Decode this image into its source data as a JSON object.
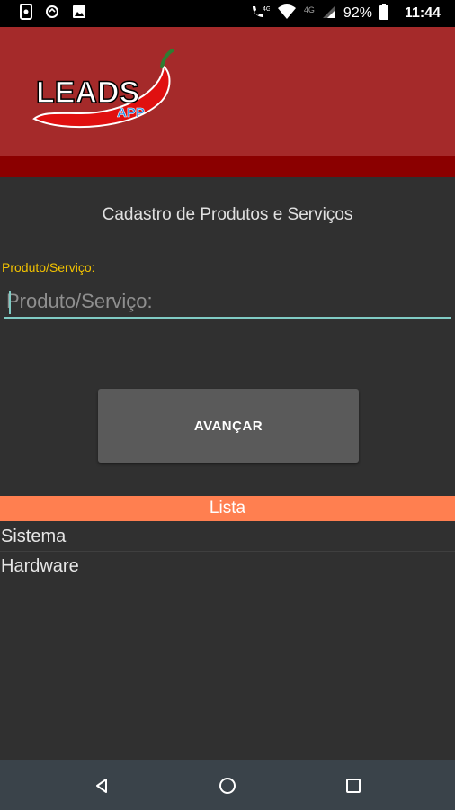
{
  "status_bar": {
    "icons_left": [
      "phone-icon",
      "sync-icon",
      "image-icon"
    ],
    "network_label": "4G",
    "battery": "92%",
    "time": "11:44"
  },
  "header": {
    "logo_text": "LEADS",
    "logo_sub": "APP",
    "background_color": "#a52a2a",
    "stripe_color": "#8b0000"
  },
  "main": {
    "title": "Cadastro de Produtos e Serviços",
    "field_label": "Produto/Serviço:",
    "input_placeholder": "Produto/Serviço:",
    "input_value": "",
    "advance_button": "AVANÇAR"
  },
  "list": {
    "header": "Lista",
    "header_color": "#ff7f50",
    "items": [
      "Sistema",
      "Hardware"
    ]
  },
  "nav_bar": {
    "buttons": [
      "back-icon",
      "home-icon",
      "recents-icon"
    ]
  }
}
